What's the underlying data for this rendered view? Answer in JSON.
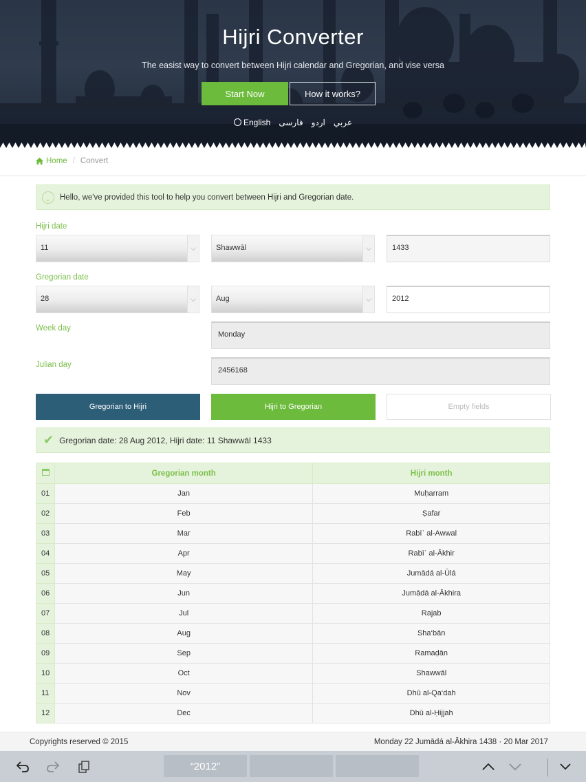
{
  "hero": {
    "title": "Hijri Converter",
    "subtitle": "The easist way to convert between Hijri calendar and Gregorian, and vise versa",
    "start_button": "Start Now",
    "how_button": "How it works?",
    "languages": [
      "English",
      "فارسی",
      "اردو",
      "عربي"
    ]
  },
  "breadcrumb": {
    "home": "Home",
    "separator": "/",
    "current": "Convert"
  },
  "info_alert": "Hello, we've provided this tool to help you convert between Hijri and Gregorian date.",
  "form": {
    "hijri_label": "Hijri date",
    "hijri_day": "11",
    "hijri_month": "Shawwāl",
    "hijri_year": "1433",
    "gregorian_label": "Gregorian date",
    "gregorian_day": "28",
    "gregorian_month": "Aug",
    "gregorian_year": "2012",
    "weekday_label": "Week day",
    "weekday_value": "Monday",
    "julian_label": "Julian day",
    "julian_value": "2456168"
  },
  "actions": {
    "g2h": "Gregorian to Hijri",
    "h2g": "Hijri to Gregorian",
    "empty": "Empty fields"
  },
  "result_alert": "Gregorian date: 28 Aug 2012, Hijri date: 11 Shawwāl 1433",
  "table": {
    "headers": [
      "Gregorian month",
      "Hijri month"
    ],
    "rows": [
      {
        "num": "01",
        "greg": "Jan",
        "hijri": "Muḥarram"
      },
      {
        "num": "02",
        "greg": "Feb",
        "hijri": "Ṣafar"
      },
      {
        "num": "03",
        "greg": "Mar",
        "hijri": "Rabīʿ al-Awwal"
      },
      {
        "num": "04",
        "greg": "Apr",
        "hijri": "Rabīʿ al-Ākhir"
      },
      {
        "num": "05",
        "greg": "May",
        "hijri": "Jumādá al-Ūlá"
      },
      {
        "num": "06",
        "greg": "Jun",
        "hijri": "Jumādá al-Ākhira"
      },
      {
        "num": "07",
        "greg": "Jul",
        "hijri": "Rajab"
      },
      {
        "num": "08",
        "greg": "Aug",
        "hijri": "Sha‘bān"
      },
      {
        "num": "09",
        "greg": "Sep",
        "hijri": "Ramaḍān"
      },
      {
        "num": "10",
        "greg": "Oct",
        "hijri": "Shawwāl"
      },
      {
        "num": "11",
        "greg": "Nov",
        "hijri": "Dhū al-Qa‘dah"
      },
      {
        "num": "12",
        "greg": "Dec",
        "hijri": "Dhū al-Ḥijjah"
      }
    ]
  },
  "footer": {
    "copyright": "Copyrights reserved © 2015",
    "today": "Monday 22 Jumādá al-Ākhira 1438 · 20 Mar 2017"
  },
  "keyboard": {
    "suggestion": "“2012”",
    "icons": [
      "undo-icon",
      "redo-icon",
      "clipboard-icon",
      "chevron-up-icon",
      "chevron-down-icon",
      "hide-keyboard-icon"
    ]
  },
  "colors": {
    "accent_green": "#6cbb3c",
    "accent_blue": "#2d5e77",
    "pale_green": "#e6f3dc"
  }
}
